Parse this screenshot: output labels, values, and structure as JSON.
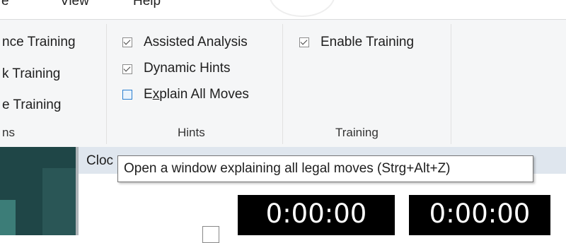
{
  "menu": {
    "items": [
      "e",
      "View",
      "Help"
    ]
  },
  "ribbon": {
    "training_group": {
      "items": [
        "nce Training",
        "k Training",
        "e Training"
      ],
      "label": "ns"
    },
    "hints_group": {
      "assisted_analysis": {
        "label": "Assisted Analysis",
        "checked": true
      },
      "dynamic_hints": {
        "label": "Dynamic Hints",
        "checked": true
      },
      "explain_all_moves": {
        "label_pre": "E",
        "label_underline": "x",
        "label_post": "plain All Moves",
        "checked": false
      },
      "label": "Hints"
    },
    "enable_group": {
      "enable_training": {
        "label": "Enable Training",
        "checked": true
      },
      "label": "Training"
    }
  },
  "clock": {
    "title": "Cloc",
    "time_left": "0:00:00",
    "time_right": "0:00:00"
  },
  "tooltip": {
    "text": "Open a window explaining all legal moves (Strg+Alt+Z)"
  }
}
